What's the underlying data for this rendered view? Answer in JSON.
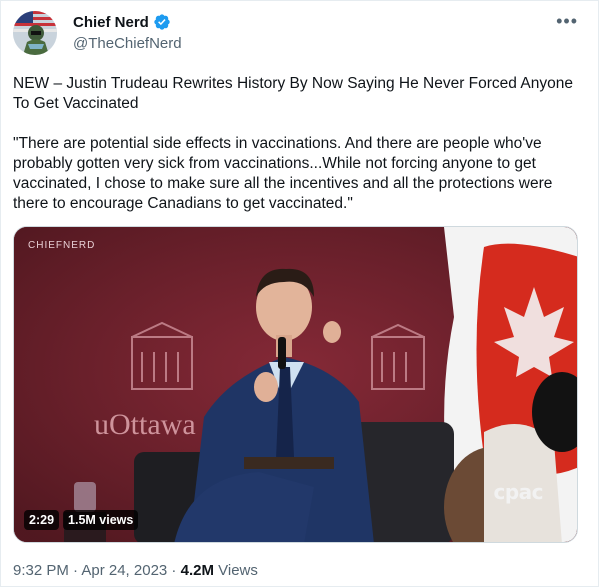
{
  "author": {
    "display_name": "Chief Nerd",
    "handle": "@TheChiefNerd",
    "verified": true,
    "verified_icon": "verified-badge-icon",
    "avatar_icon": "avatar-image"
  },
  "more_icon": "more-options-icon",
  "tweet": {
    "headline": "NEW – Justin Trudeau Rewrites History By Now Saying He Never Forced Anyone To Get Vaccinated",
    "quote": "\"There are potential side effects in vaccinations. And there are people who've  probably gotten very sick from vaccinations...While not forcing anyone to get vaccinated, I chose to make sure all the incentives and all the protections were there to encourage Canadians to get vaccinated.\""
  },
  "video": {
    "watermark_top": "CHIEFNERD",
    "backdrop_text": "uOttawa",
    "broadcaster_logo": "cpac",
    "duration": "2:29",
    "views": "1.5M views"
  },
  "meta": {
    "timestamp": "9:32 PM · Apr 24, 2023",
    "separator": " · ",
    "view_count": "4.2M",
    "view_label": " Views"
  },
  "colors": {
    "accent": "#1d9bf0",
    "backdrop": "#7a2431",
    "flag_red": "#d52b1e",
    "secondary_text": "#536471"
  }
}
